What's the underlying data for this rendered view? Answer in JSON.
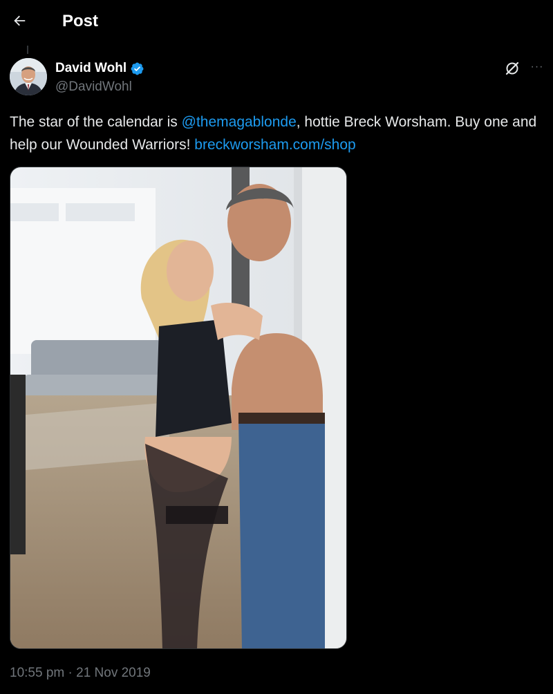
{
  "header": {
    "back_icon": "arrow-left-icon",
    "title": "Post"
  },
  "author": {
    "name": "David Wohl",
    "handle": "@DavidWohl",
    "verified": true,
    "verified_color": "#1d9bf0"
  },
  "post": {
    "text_before_mention": "The star of the calendar is ",
    "mention": "@themagablonde",
    "text_after_mention": ", hottie Breck Worsham. Buy one and help our Wounded Warriors! ",
    "link": "breckworsham.com/shop",
    "link_color": "#1d9bf0"
  },
  "actions": {
    "grok_icon": "grok-icon",
    "more_icon": "more-horizontal-icon",
    "more_label": "···"
  },
  "meta": {
    "time": "10:55 pm",
    "separator": " · ",
    "date": "21 Nov 2019"
  },
  "colors": {
    "background": "#000000",
    "primary_text": "#e7e9ea",
    "secondary_text": "#71767b",
    "accent": "#1d9bf0"
  }
}
